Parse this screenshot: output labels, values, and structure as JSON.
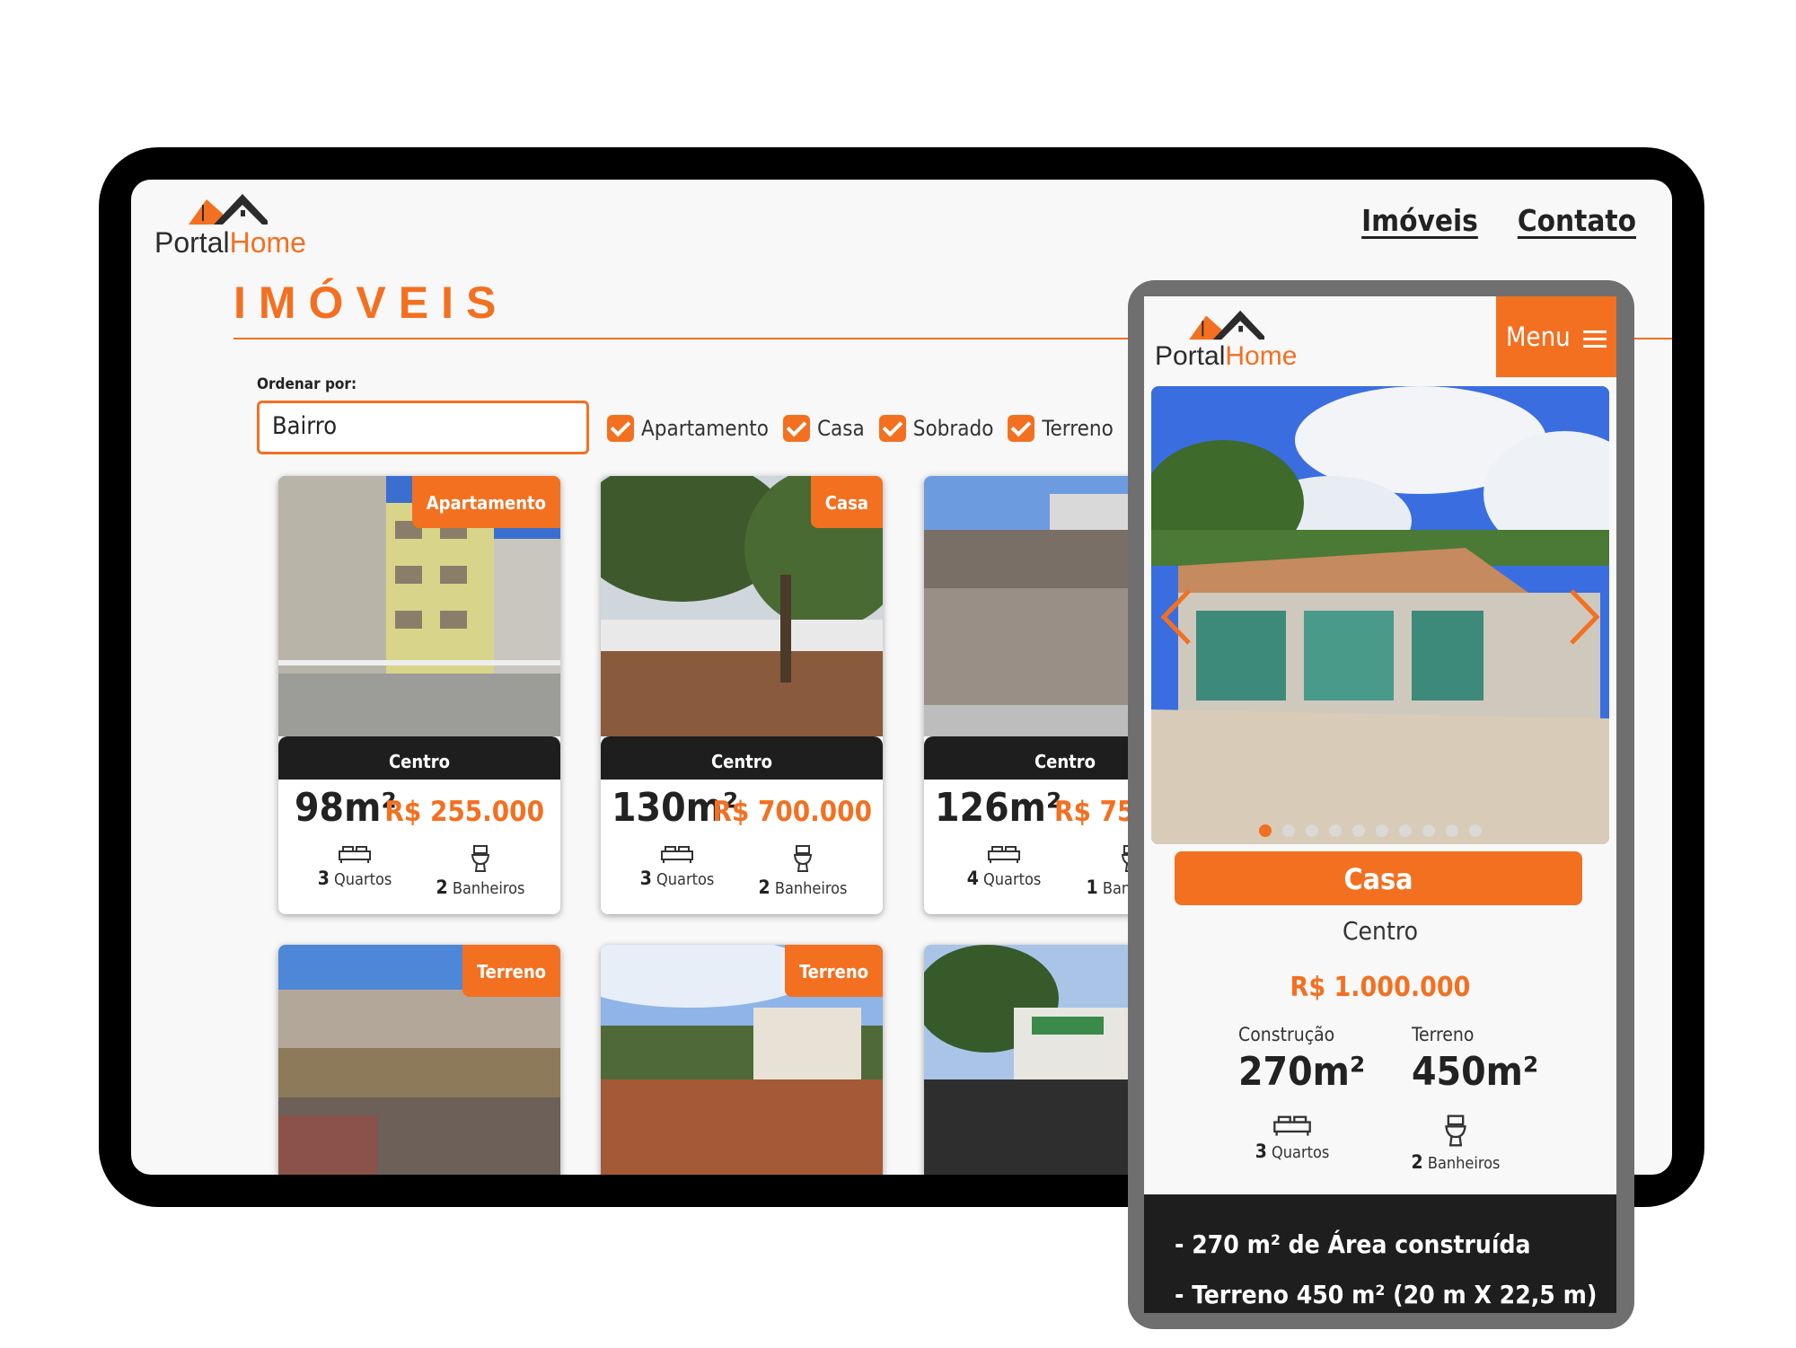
{
  "brand": {
    "part1": "Portal",
    "part2": "Home"
  },
  "nav": {
    "items": [
      "Imóveis",
      "Contato"
    ]
  },
  "page": {
    "title": "IMÓVEIS"
  },
  "sort": {
    "label": "Ordenar por:",
    "value": "Bairro"
  },
  "filters": [
    "Apartamento",
    "Casa",
    "Sobrado",
    "Terreno"
  ],
  "units": {
    "area": "m²",
    "rooms": "Quartos",
    "baths": "Banheiros"
  },
  "listings": [
    {
      "type": "Apartamento",
      "neighborhood": "Centro",
      "area": "98",
      "price": "R$ 255.000",
      "rooms": "3",
      "baths": "2"
    },
    {
      "type": "Casa",
      "neighborhood": "Centro",
      "area": "130",
      "price": "R$ 700.000",
      "rooms": "3",
      "baths": "2"
    },
    {
      "type": "",
      "neighborhood": "Centro",
      "area": "126",
      "price": "R$ 750",
      "rooms": "4",
      "baths": "1"
    },
    {
      "type": "Terreno",
      "neighborhood": "",
      "area": "",
      "price": "",
      "rooms": "",
      "baths": ""
    },
    {
      "type": "Terreno",
      "neighborhood": "",
      "area": "",
      "price": "",
      "rooms": "",
      "baths": ""
    },
    {
      "type": "",
      "neighborhood": "",
      "area": "",
      "price": "",
      "rooms": "",
      "baths": ""
    }
  ],
  "mobile": {
    "menu_label": "Menu",
    "type": "Casa",
    "neighborhood": "Centro",
    "price": "R$ 1.000.000",
    "construction_label": "Construção",
    "construction_value": "270m²",
    "land_label": "Terreno",
    "land_value": "450m²",
    "rooms": "3",
    "baths": "2",
    "description": [
      "- 270 m² de Área construída",
      "- Terreno 450 m² (20 m X 22,5 m)"
    ],
    "slides_total": 10,
    "slide_active": 1
  },
  "colors": {
    "accent": "#f37021",
    "dark": "#1e1e1e"
  }
}
